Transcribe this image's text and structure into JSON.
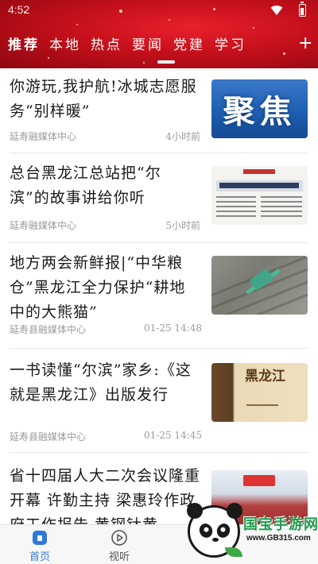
{
  "status_bar": {
    "time": "4:52"
  },
  "header": {
    "background_color": "#c4101b",
    "tabs": [
      {
        "label": "推荐",
        "active": true
      },
      {
        "label": "本地",
        "active": false
      },
      {
        "label": "热点",
        "active": false
      },
      {
        "label": "要闻",
        "active": false
      },
      {
        "label": "党建",
        "active": false
      },
      {
        "label": "学习",
        "active": false
      }
    ],
    "add_icon": "plus-icon",
    "add_label": "+"
  },
  "news": [
    {
      "title": "你游玩,我护航!冰城志愿服务“别样暖”",
      "source": "延寿融媒体中心",
      "time": "4小时前",
      "thumbnail_text": "聚焦"
    },
    {
      "title": "总台黑龙江总站把“尔滨”的故事讲给你听",
      "source": "延寿融媒体中心",
      "time": "5小时前",
      "thumbnail_text": ""
    },
    {
      "title": "地方两会新鲜报|“中华粮仓”黑龙江全力保护“耕地中的大熊猫”",
      "source": "延寿县融媒体中心",
      "time": "01-25 14:48",
      "thumbnail_text": ""
    },
    {
      "title": "一书读懂“尔滨”家乡:《这就是黑龙江》出版发行",
      "source": "延寿县融媒体中心",
      "time": "01-25 14:45",
      "thumbnail_text": "黑龙江"
    },
    {
      "title": "省十四届人大二次会议隆重开幕 许勤主持 梁惠玲作政府工作报告 黄钢钛黄",
      "source": "",
      "time": "",
      "thumbnail_text": ""
    }
  ],
  "bottom_nav": {
    "active_color": "#2f7ad9",
    "inactive_color": "#555555",
    "items": [
      {
        "label": "首页",
        "icon": "home-icon",
        "active": true
      },
      {
        "label": "视听",
        "icon": "play-icon",
        "active": false
      }
    ]
  },
  "watermark": {
    "brand": "国宝手游网",
    "url": "www.GB315.com"
  }
}
